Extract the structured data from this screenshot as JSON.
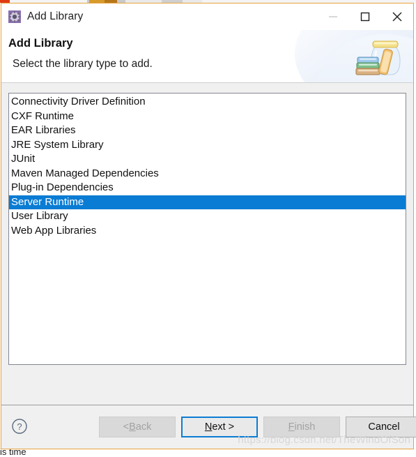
{
  "window": {
    "title": "Add Library",
    "icon": "gear-icon",
    "controls": {
      "minimize": "minimize-icon",
      "maximize": "maximize-icon",
      "close": "close-icon"
    },
    "border_color": "#e8a33d"
  },
  "header": {
    "title": "Add Library",
    "subtitle": "Select the library type to add.",
    "banner_icon": "books-jar-icon"
  },
  "list": {
    "selected_index": 7,
    "selection_color": "#0a7cd4",
    "items": [
      {
        "label": "Connectivity Driver Definition"
      },
      {
        "label": "CXF Runtime"
      },
      {
        "label": "EAR Libraries"
      },
      {
        "label": "JRE System Library"
      },
      {
        "label": "JUnit"
      },
      {
        "label": "Maven Managed Dependencies"
      },
      {
        "label": "Plug-in Dependencies"
      },
      {
        "label": "Server Runtime"
      },
      {
        "label": "User Library"
      },
      {
        "label": "Web App Libraries"
      }
    ]
  },
  "footer": {
    "help_icon": "help-question-icon",
    "buttons": [
      {
        "label": "< Back",
        "mnemonic": "B",
        "prefix": "< ",
        "suffix": "ack",
        "state": "disabled"
      },
      {
        "label": "Next >",
        "mnemonic": "N",
        "prefix": "",
        "suffix": "ext >",
        "state": "focused"
      },
      {
        "label": "Finish",
        "mnemonic": "F",
        "prefix": "",
        "suffix": "inish",
        "state": "disabled"
      },
      {
        "label": "Cancel",
        "mnemonic": "",
        "prefix": "Cancel",
        "suffix": "",
        "state": "enabled"
      }
    ]
  },
  "watermark": {
    "text": "https://blog.csdn.net/TheWindOfSon"
  },
  "background": {
    "bottom_text": "is time"
  }
}
